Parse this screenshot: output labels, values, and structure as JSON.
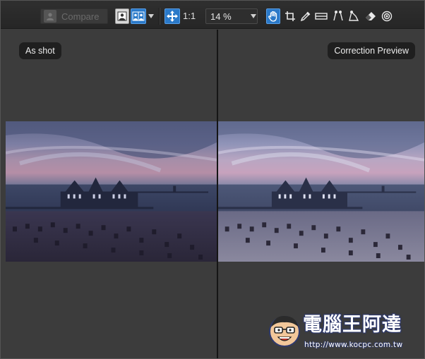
{
  "toolbar": {
    "compare_label": "Compare",
    "zoom_one_one": "1:1",
    "zoom_value": "14 %",
    "accent": "#2a79c9"
  },
  "left_panel": {
    "badge": "As shot"
  },
  "right_panel": {
    "badge": "Correction Preview"
  },
  "icons": [
    "user-icon",
    "single-view-icon",
    "split-view-icon",
    "move-arrows-icon",
    "hand-icon",
    "crop-icon",
    "eyedropper-icon",
    "straighten-icon",
    "keystone-vertical-icon",
    "keystone-icon",
    "eraser-icon",
    "target-icon"
  ],
  "watermark": {
    "title": "電腦王阿達",
    "url": "http://www.kocpc.com.tw"
  }
}
